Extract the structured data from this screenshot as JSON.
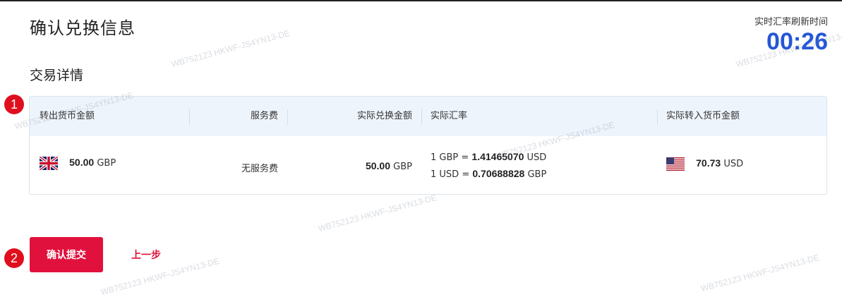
{
  "page": {
    "title": "确认兑换信息",
    "timer_label": "实时汇率刷新时间",
    "timer_value": "00:26",
    "section_title": "交易详情"
  },
  "table": {
    "headers": [
      "转出货币金额",
      "服务费",
      "实际兑换金额",
      "实际汇率",
      "实际转入货币金额"
    ],
    "row": {
      "sell_amount": "50.00",
      "sell_currency": "GBP",
      "service_fee": "无服务费",
      "exchange_amount": "50.00",
      "exchange_currency": "GBP",
      "rate1_prefix": "1 GBP =",
      "rate1_value": "1.41465070",
      "rate1_currency": "USD",
      "rate2_prefix": "1 USD =",
      "rate2_value": "0.70688828",
      "rate2_currency": "GBP",
      "buy_amount": "70.73",
      "buy_currency": "USD"
    }
  },
  "markers": [
    "1",
    "2"
  ],
  "actions": {
    "confirm_label": "确认提交",
    "back_label": "上一步"
  },
  "watermark": "WB752123 HKWF-JS4YN13-DE",
  "icons": {
    "sell_flag": "uk-flag-icon",
    "buy_flag": "us-flag-icon"
  },
  "colors": {
    "accent": "#e0123d",
    "timer": "#2557d6",
    "header_bg": "#eef4fc",
    "marker": "#e00f1e"
  }
}
